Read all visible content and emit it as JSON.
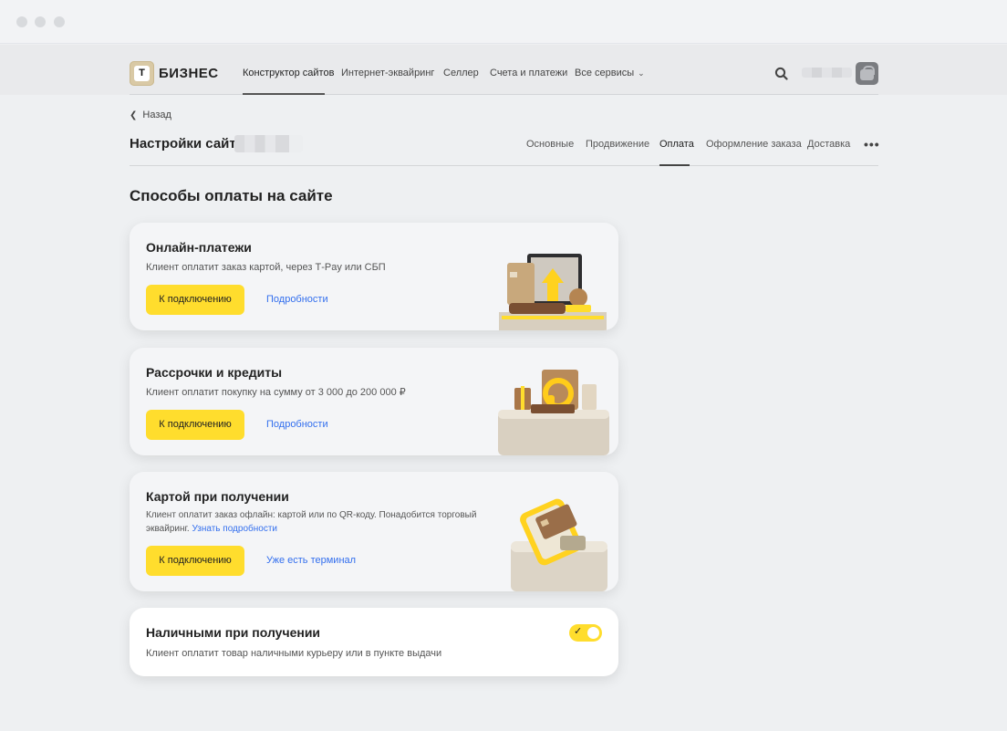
{
  "header": {
    "logo_letter": "Т",
    "logo_text": "БИЗНЕС",
    "nav": [
      {
        "label": "Конструктор сайтов"
      },
      {
        "label": "Интернет-эквайринг"
      },
      {
        "label": "Селлер"
      },
      {
        "label": "Счета и платежи"
      },
      {
        "label": "Все сервисы"
      }
    ]
  },
  "page": {
    "back_label": "Назад",
    "title": "Настройки сайта",
    "tabs": [
      {
        "label": "Основные"
      },
      {
        "label": "Продвижение"
      },
      {
        "label": "Оплата"
      },
      {
        "label": "Оформление заказа"
      },
      {
        "label": "Доставка"
      }
    ],
    "more_label": "•••",
    "section_title": "Способы оплаты на сайте"
  },
  "cards": [
    {
      "title": "Онлайн-платежи",
      "description": "Клиент оплатит заказ картой, через T‑Pay или СБП",
      "button": "К подключению",
      "link": "Подробности"
    },
    {
      "title": "Рассрочки и кредиты",
      "description": "Клиент оплатит покупку на сумму от 3 000 до 200 000 ₽",
      "button": "К подключению",
      "link": "Подробности"
    },
    {
      "title": "Картой при получении",
      "description": "Клиент оплатит заказ офлайн: картой или по QR-коду. Понадобится торговый эквайринг.",
      "description_link": "Узнать подробности",
      "button": "К подключению",
      "link": "Уже есть терминал"
    },
    {
      "title": "Наличными при получении",
      "description": "Клиент оплатит товар наличными курьеру или в пункте выдачи",
      "toggle_on": true
    }
  ],
  "colors": {
    "accent": "#ffdd2d",
    "link": "#336fee"
  }
}
